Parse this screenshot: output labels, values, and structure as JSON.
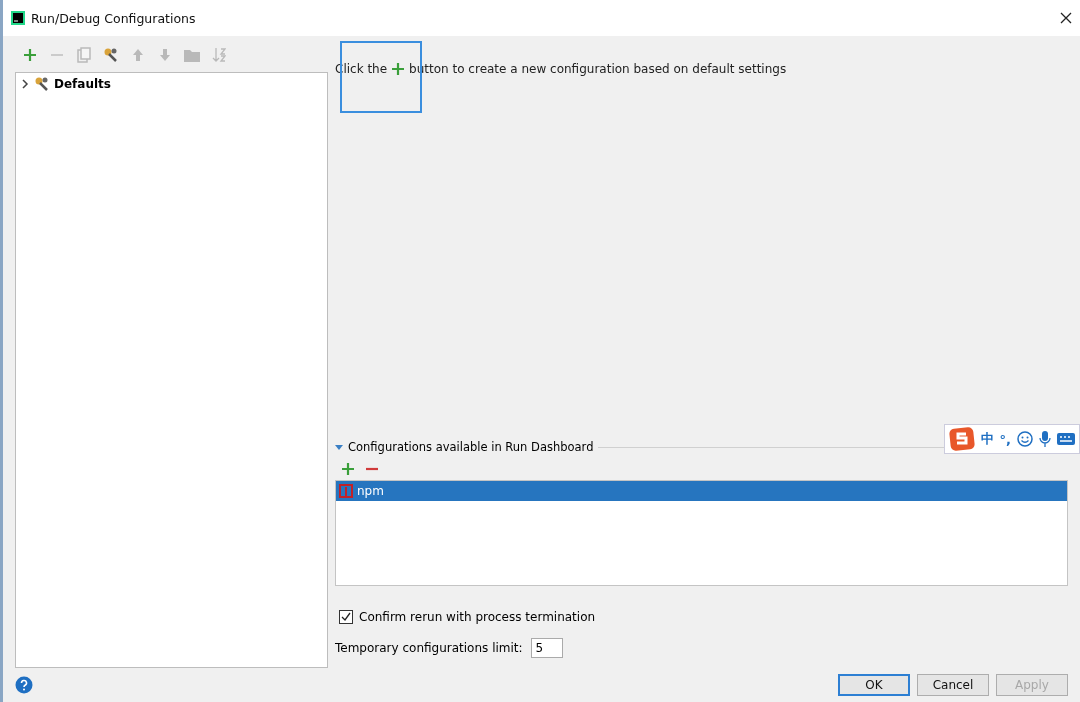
{
  "window": {
    "title": "Run/Debug Configurations"
  },
  "toolbar": [
    {
      "kind": "add",
      "disabled": false
    },
    {
      "kind": "remove",
      "disabled": true
    },
    {
      "kind": "copy",
      "disabled": true
    },
    {
      "kind": "wrench",
      "disabled": false
    },
    {
      "kind": "up",
      "disabled": true
    },
    {
      "kind": "down",
      "disabled": true
    },
    {
      "kind": "folder",
      "disabled": true
    },
    {
      "kind": "sort",
      "disabled": true
    }
  ],
  "tree": [
    {
      "label": "Defaults",
      "expanded": false
    }
  ],
  "hint": {
    "before": "Click the",
    "after": "button to create a new configuration based on default settings"
  },
  "dashboard": {
    "title": "Configurations available in Run Dashboard",
    "expanded": true,
    "items": [
      {
        "label": "npm",
        "selected": true
      }
    ]
  },
  "confirm_rerun": {
    "label": "Confirm rerun with process termination",
    "checked": true
  },
  "temp_limit": {
    "label": "Temporary configurations limit:",
    "value": "5"
  },
  "buttons": [
    {
      "label": "OK",
      "kind": "default",
      "disabled": false
    },
    {
      "label": "Cancel",
      "kind": "normal",
      "disabled": false
    },
    {
      "label": "Apply",
      "kind": "normal",
      "disabled": true
    }
  ],
  "ime": {
    "items": [
      "中",
      "°,"
    ]
  }
}
